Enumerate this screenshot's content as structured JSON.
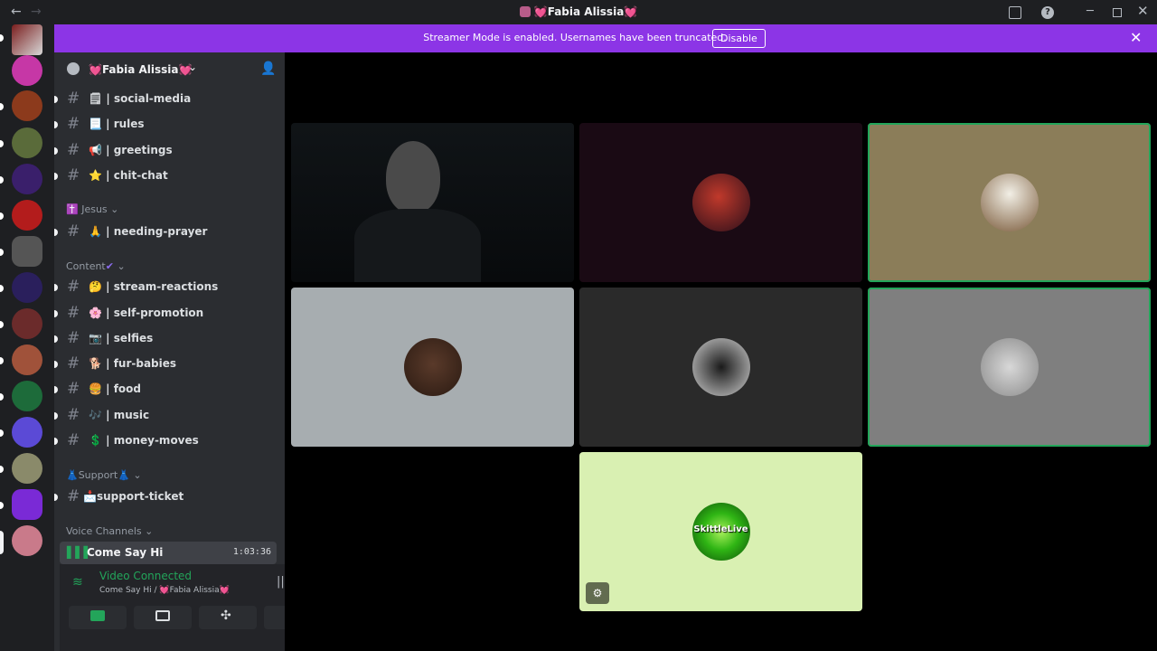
{
  "window": {
    "title": "💓Fabia Alissia💓",
    "back_icon": "arrow-left-icon",
    "forward_icon": "arrow-right-icon",
    "controls": [
      "inbox-icon",
      "help-icon",
      "minimize-icon",
      "maximize-icon",
      "close-icon"
    ]
  },
  "banner": {
    "message": "Streamer Mode is enabled. Usernames have been truncated.",
    "disable_label": "Disable",
    "close_icon": "close-icon",
    "color": "#8c35e6"
  },
  "server": {
    "name": "💓Fabia Alissia💓",
    "chevron": "chevron-down-icon",
    "invite_icon": "add-user-icon"
  },
  "channels_top": [
    {
      "emoji": "🗒",
      "label": "| social-media"
    },
    {
      "emoji": "📃",
      "label": "| rules"
    },
    {
      "emoji": "📢",
      "label": "| greetings"
    },
    {
      "emoji": "⭐",
      "label": "| chit-chat"
    }
  ],
  "category_jesus": {
    "emoji": "✝️",
    "label": "Jesus"
  },
  "channels_jesus": [
    {
      "emoji": "🙏",
      "label": "| needing-prayer"
    }
  ],
  "category_content": {
    "label": "Content",
    "badge": "✔"
  },
  "channels_content": [
    {
      "emoji": "🤔",
      "label": "| stream-reactions"
    },
    {
      "emoji": "🌸",
      "label": "| self-promotion"
    },
    {
      "emoji": "📷",
      "label": "| selfies"
    },
    {
      "emoji": "🐕",
      "label": "| fur-babies"
    },
    {
      "emoji": "🍔",
      "label": "| food"
    },
    {
      "emoji": "🎶",
      "label": "| music"
    },
    {
      "emoji": "💲",
      "label": "| money-moves"
    }
  ],
  "category_support": {
    "emoji": "👗",
    "label": "Support",
    "emoji_end": "👗"
  },
  "channels_support": [
    {
      "emoji": "📩",
      "label": "support-ticket"
    }
  ],
  "category_voice": {
    "label": "Voice Channels"
  },
  "voice_channel": {
    "label": "Come Say Hi",
    "timer": "1:03:36"
  },
  "rtc_panel": {
    "status": "Video Connected",
    "location": "Come Say Hi / 💓Fabia Alissia💓",
    "buttons": [
      "camera-icon",
      "screen-share-icon",
      "activities-icon",
      "soundboard-icon"
    ],
    "status_color": "#23a55a"
  },
  "video_tiles": [
    {
      "kind": "camera",
      "speaking": false
    },
    {
      "kind": "avatar",
      "bg": "#1a0a14",
      "speaking": false
    },
    {
      "kind": "avatar",
      "bg": "#8b7d59",
      "speaking": true
    },
    {
      "kind": "avatar",
      "bg": "#a7adb0",
      "speaking": false
    },
    {
      "kind": "avatar",
      "bg": "#2a2a2a",
      "speaking": false
    },
    {
      "kind": "avatar",
      "bg": "#7f7f7f",
      "speaking": true
    },
    {
      "kind": "avatar",
      "bg": "#d9f0b2",
      "avatar_text": "SkittleLive",
      "speaking": false,
      "icon": "mic-settings-icon"
    }
  ]
}
